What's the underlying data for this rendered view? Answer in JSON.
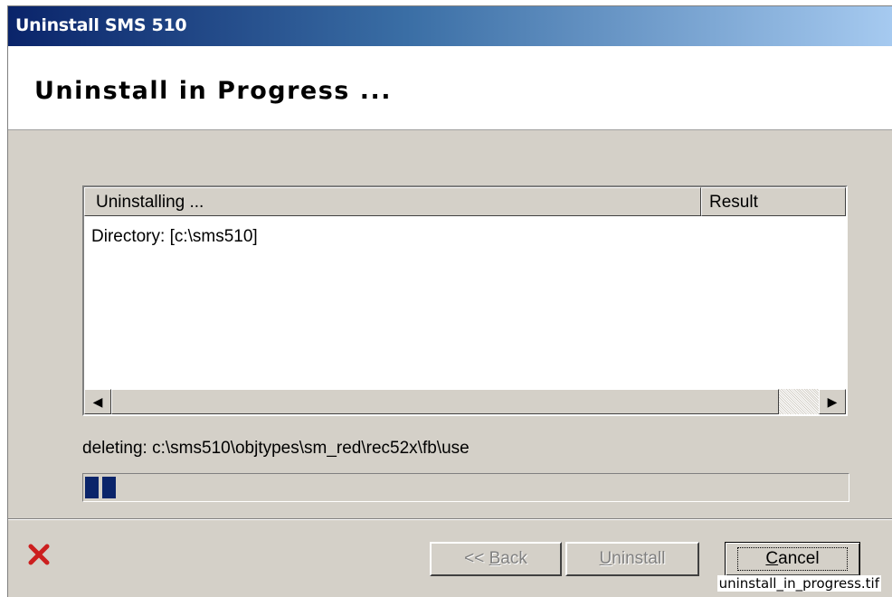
{
  "window": {
    "title": "Uninstall SMS 510"
  },
  "header": {
    "heading": "Uninstall in Progress ..."
  },
  "list": {
    "columns": [
      "Uninstalling ...",
      "Result"
    ],
    "rows": [
      {
        "item": "Directory: [c:\\sms510]",
        "result": ""
      }
    ]
  },
  "status": {
    "text": "deleting: c:\\sms510\\objtypes\\sm_red\\rec52x\\fb\\use"
  },
  "progress": {
    "fraction": 0.05
  },
  "buttons": {
    "back": {
      "prefix": "<< ",
      "mnemonic": "B",
      "rest": "ack",
      "enabled": false
    },
    "uninstall": {
      "mnemonic": "U",
      "rest": "ninstall",
      "enabled": false
    },
    "cancel": {
      "mnemonic": "C",
      "rest": "ancel",
      "enabled": true
    }
  },
  "caption": "uninstall_in_progress.tif",
  "icons": {
    "cancel_mark": "red-x-icon",
    "scroll_left": "arrow-left-icon",
    "scroll_right": "arrow-right-icon"
  },
  "colors": {
    "title_gradient_start": "#0a246a",
    "title_gradient_end": "#a6caf0",
    "progress_fill": "#0a246a",
    "x_icon": "#cc1f1f"
  }
}
